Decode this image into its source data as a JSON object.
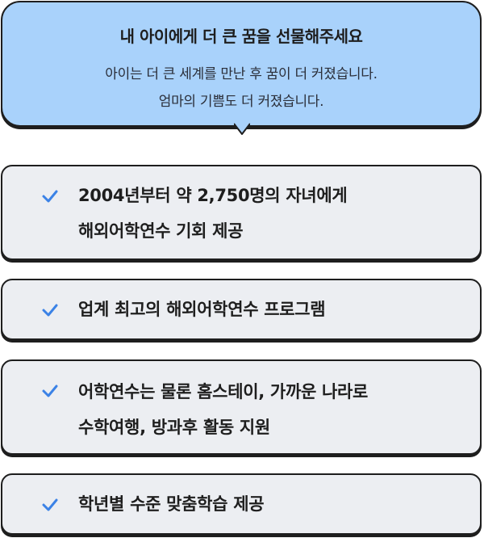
{
  "bubble": {
    "title": "내 아이에게 더 큰 꿈을 선물해주세요",
    "line1": "아이는 더 큰 세계를 만난 후 꿈이 더 커졌습니다.",
    "line2": "엄마의 기쁨도 더 커졌습니다."
  },
  "items": [
    {
      "icon": "checkmark-icon",
      "line1": "2004년부터 약 2,750명의 자녀에게",
      "line2": "해외어학연수 기회 제공"
    },
    {
      "icon": "checkmark-icon",
      "line1": "업계 최고의 해외어학연수 프로그램"
    },
    {
      "icon": "checkmark-icon",
      "line1": "어학연수는 물론 홈스테이, 가까운 나라로",
      "line2": "수학여행, 방과후 활동 지원"
    },
    {
      "icon": "checkmark-icon",
      "line1": "학년별 수준 맞춤학습 제공"
    }
  ],
  "colors": {
    "bubble": "#a9d2fb",
    "card": "#eceef2",
    "check": "#3b82e6",
    "border": "#1e1e1e"
  }
}
